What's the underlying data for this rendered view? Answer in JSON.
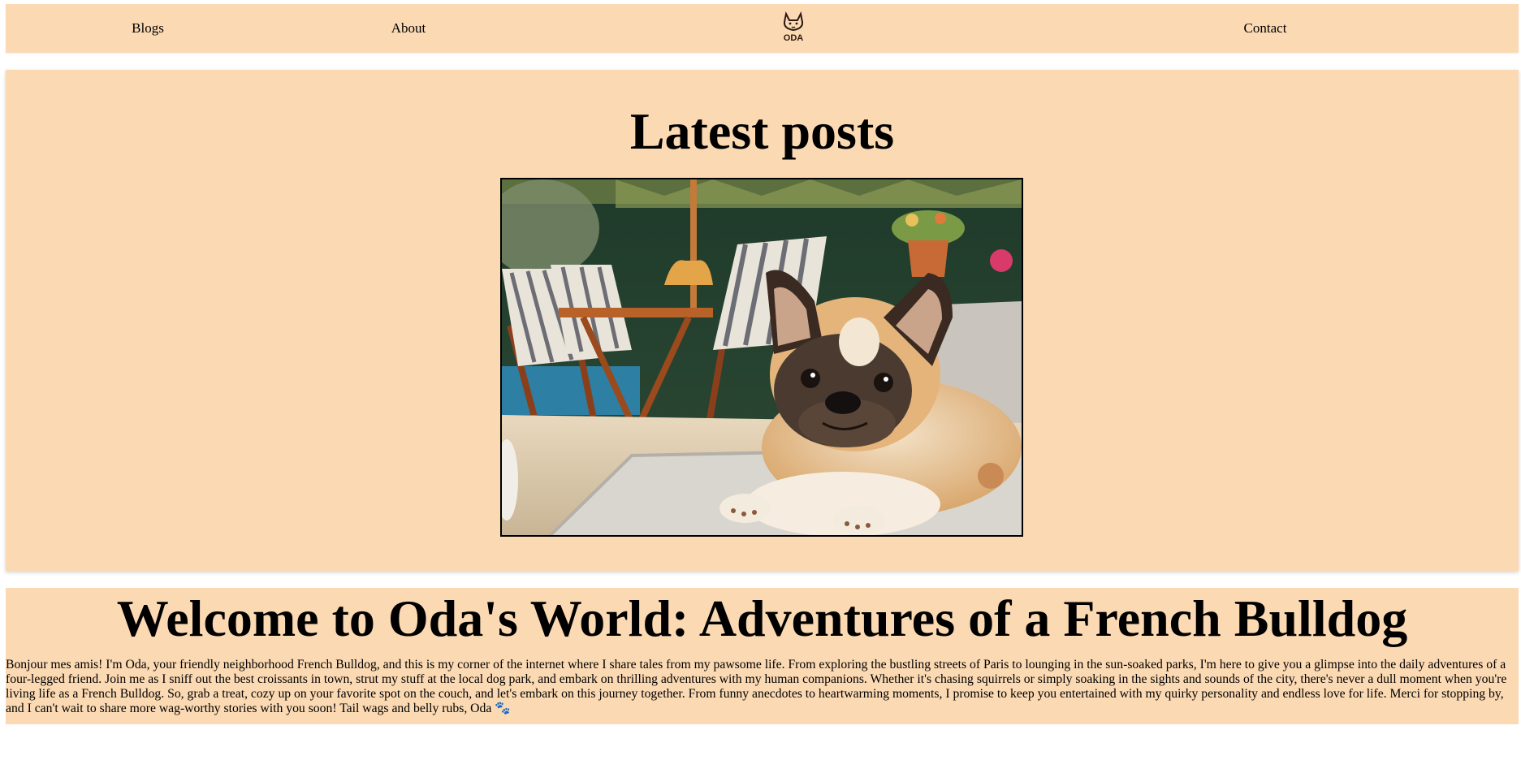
{
  "nav": {
    "blogs_label": "Blogs",
    "about_label": "About",
    "logo_text": "ODA",
    "contact_label": "Contact"
  },
  "latest": {
    "heading": "Latest posts"
  },
  "welcome": {
    "heading": "Welcome to Oda's World: Adventures of a French Bulldog",
    "body": "Bonjour mes amis! I'm Oda, your friendly neighborhood French Bulldog, and this is my corner of the internet where I share tales from my pawsome life. From exploring the bustling streets of Paris to lounging in the sun-soaked parks, I'm here to give you a glimpse into the daily adventures of a four-legged friend. Join me as I sniff out the best croissants in town, strut my stuff at the local dog park, and embark on thrilling adventures with my human companions. Whether it's chasing squirrels or simply soaking in the sights and sounds of the city, there's never a dull moment when you're living life as a French Bulldog. So, grab a treat, cozy up on your favorite spot on the couch, and let's embark on this journey together. From funny anecdotes to heartwarming moments, I promise to keep you entertained with my quirky personality and endless love for life. Merci for stopping by, and I can't wait to share more wag-worthy stories with you soon! Tail wags and belly rubs, Oda 🐾"
  },
  "colors": {
    "section_background": "#fbd9b3",
    "page_background": "#ffffff",
    "text": "#000000"
  }
}
